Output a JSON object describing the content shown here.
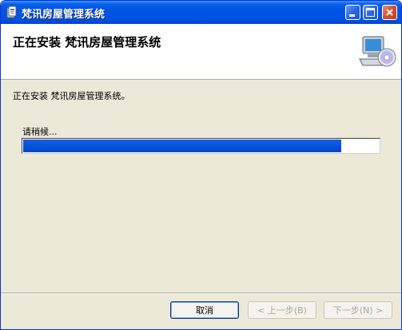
{
  "window": {
    "title": "梵讯房屋管理系统",
    "controls": [
      "minimize",
      "maximize",
      "close"
    ]
  },
  "header": {
    "title": "正在安装  梵讯房屋管理系统",
    "icon": "computer-cd-icon"
  },
  "body": {
    "status_text": "正在安装 梵讯房屋管理系统。",
    "wait_label": "请稍候...",
    "progress_fraction": 0.895
  },
  "buttons": {
    "cancel": "取消",
    "back": "< 上一步(B)",
    "next": "下一步(N) >"
  },
  "colors": {
    "titlebar": "#0054e3",
    "progress": "#0a54dc",
    "dialog_bg": "#ece9d8"
  }
}
